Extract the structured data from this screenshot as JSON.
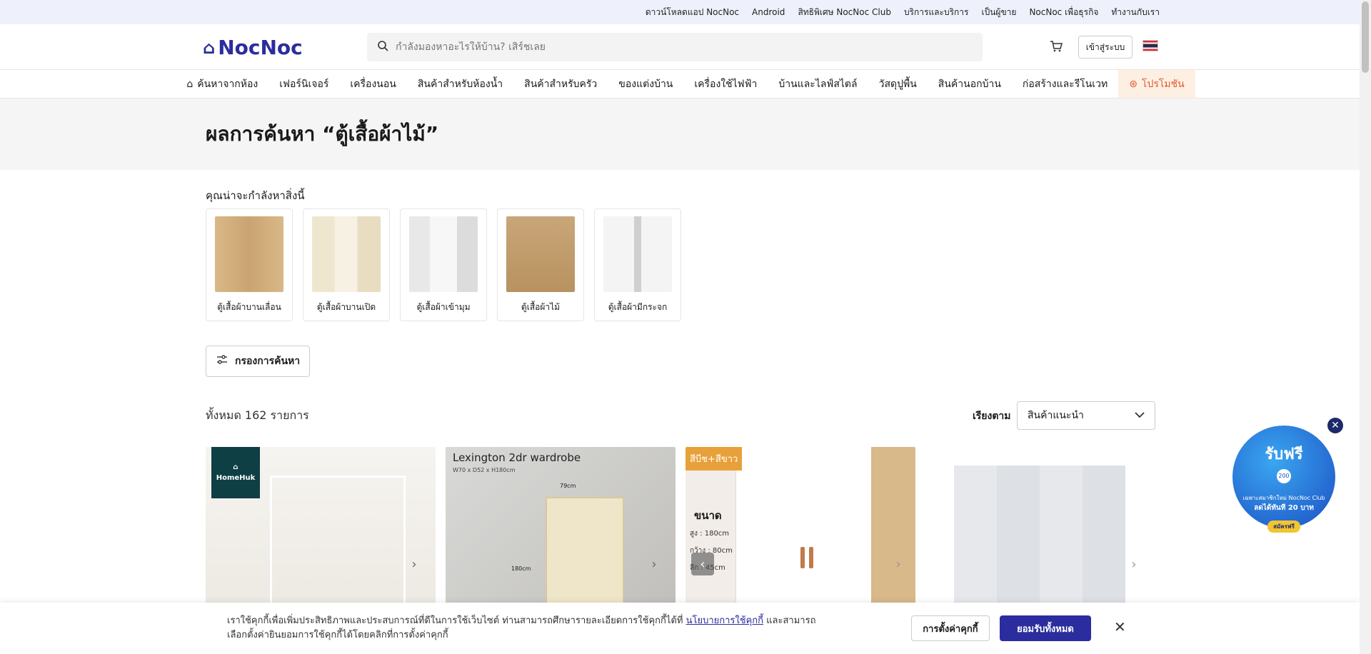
{
  "topbar": {
    "items": [
      "ดาวน์โหลดแอป NocNoc",
      "Android",
      "สิทธิพิเศษ NocNoc Club",
      "บริการและบริการ",
      "เป็นผู้ขาย",
      "NocNoc เพื่อธุรกิจ",
      "ทำงานกับเรา"
    ]
  },
  "header": {
    "logo": "NocNoc",
    "search_placeholder": "กำลังมองหาอะไรให้บ้าน? เสิร์ชเลย",
    "login": "เข้าสู่ระบบ"
  },
  "nav": {
    "items": [
      "ค้นหาจากห้อง",
      "เฟอร์นิเจอร์",
      "เครื่องนอน",
      "สินค้าสำหรับห้องน้ำ",
      "สินค้าสำหรับครัว",
      "ของแต่งบ้าน",
      "เครื่องใช้ไฟฟ้า",
      "บ้านและไลฟ์สไตล์",
      "วัสดุปูพื้น",
      "สินค้านอกบ้าน",
      "ก่อสร้างและรีโนเวท",
      "โปรโมชัน"
    ]
  },
  "results": {
    "title": "ผลการค้นหา “ตู้เสื้อผ้าไม้”",
    "suggest_title": "คุณน่าจะกำลังหาสิ่งนี้",
    "suggestions": [
      "ตู้เสื้อผ้าบานเลื่อน",
      "ตู้เสื้อผ้าบานเปิด",
      "ตู้เสื้อผ้าเข้ามุม",
      "ตู้เสื้อผ้าไม้",
      "ตู้เสื้อผ้ามีกระจก"
    ],
    "filter": "กรองการค้นหา",
    "count": "ทั้งหมด 162 รายการ",
    "sort_label": "เรียงตาม",
    "sort_value": "สินค้าแนะนำ"
  },
  "products": {
    "p1_brand": "HomeHuk",
    "p2_title": "Lexington 2dr wardrobe",
    "p2_sub": "W70 x D52 x H180cm",
    "p2_dim_w": "79cm",
    "p2_dim_h": "180cm",
    "p3_tag": "สีบีช+สีขาว",
    "p3_size": "ขนาด",
    "p3_h": "สูง : 180cm",
    "p3_w": "กว้าง : 80cm",
    "p3_d": "ลึก : 45cm"
  },
  "promo": {
    "big": "รับฟรี",
    "coin": "200",
    "small": "เฉพาะสมาชิกใหม่ NocNoc Club",
    "mid": "ลดได้ทันที 20 บาท",
    "cta": "สมัครฟรี"
  },
  "cookie": {
    "text_before": "เราใช้คุกกี้เพื่อเพิ่มประสิทธิภาพและประสบการณ์ที่ดีในการใช้เว็บไซต์ ท่านสามารถศึกษารายละเอียดการใช้คุกกี้ได้ที่",
    "link": "นโยบายการใช้คุกกี้",
    "text_after": "และสามารถเลือกตั้งค่ายินยอมการใช้คุกกี้ได้โดยคลิกที่การตั้งค่าคุกกี้",
    "settings": "การตั้งค่าคุกกี้",
    "accept": "ยอมรับทั้งหมด"
  },
  "colors": {
    "brand": "#2b2d9e",
    "promo_orange": "#e4572e",
    "topbar_bg": "#eef0fb"
  }
}
